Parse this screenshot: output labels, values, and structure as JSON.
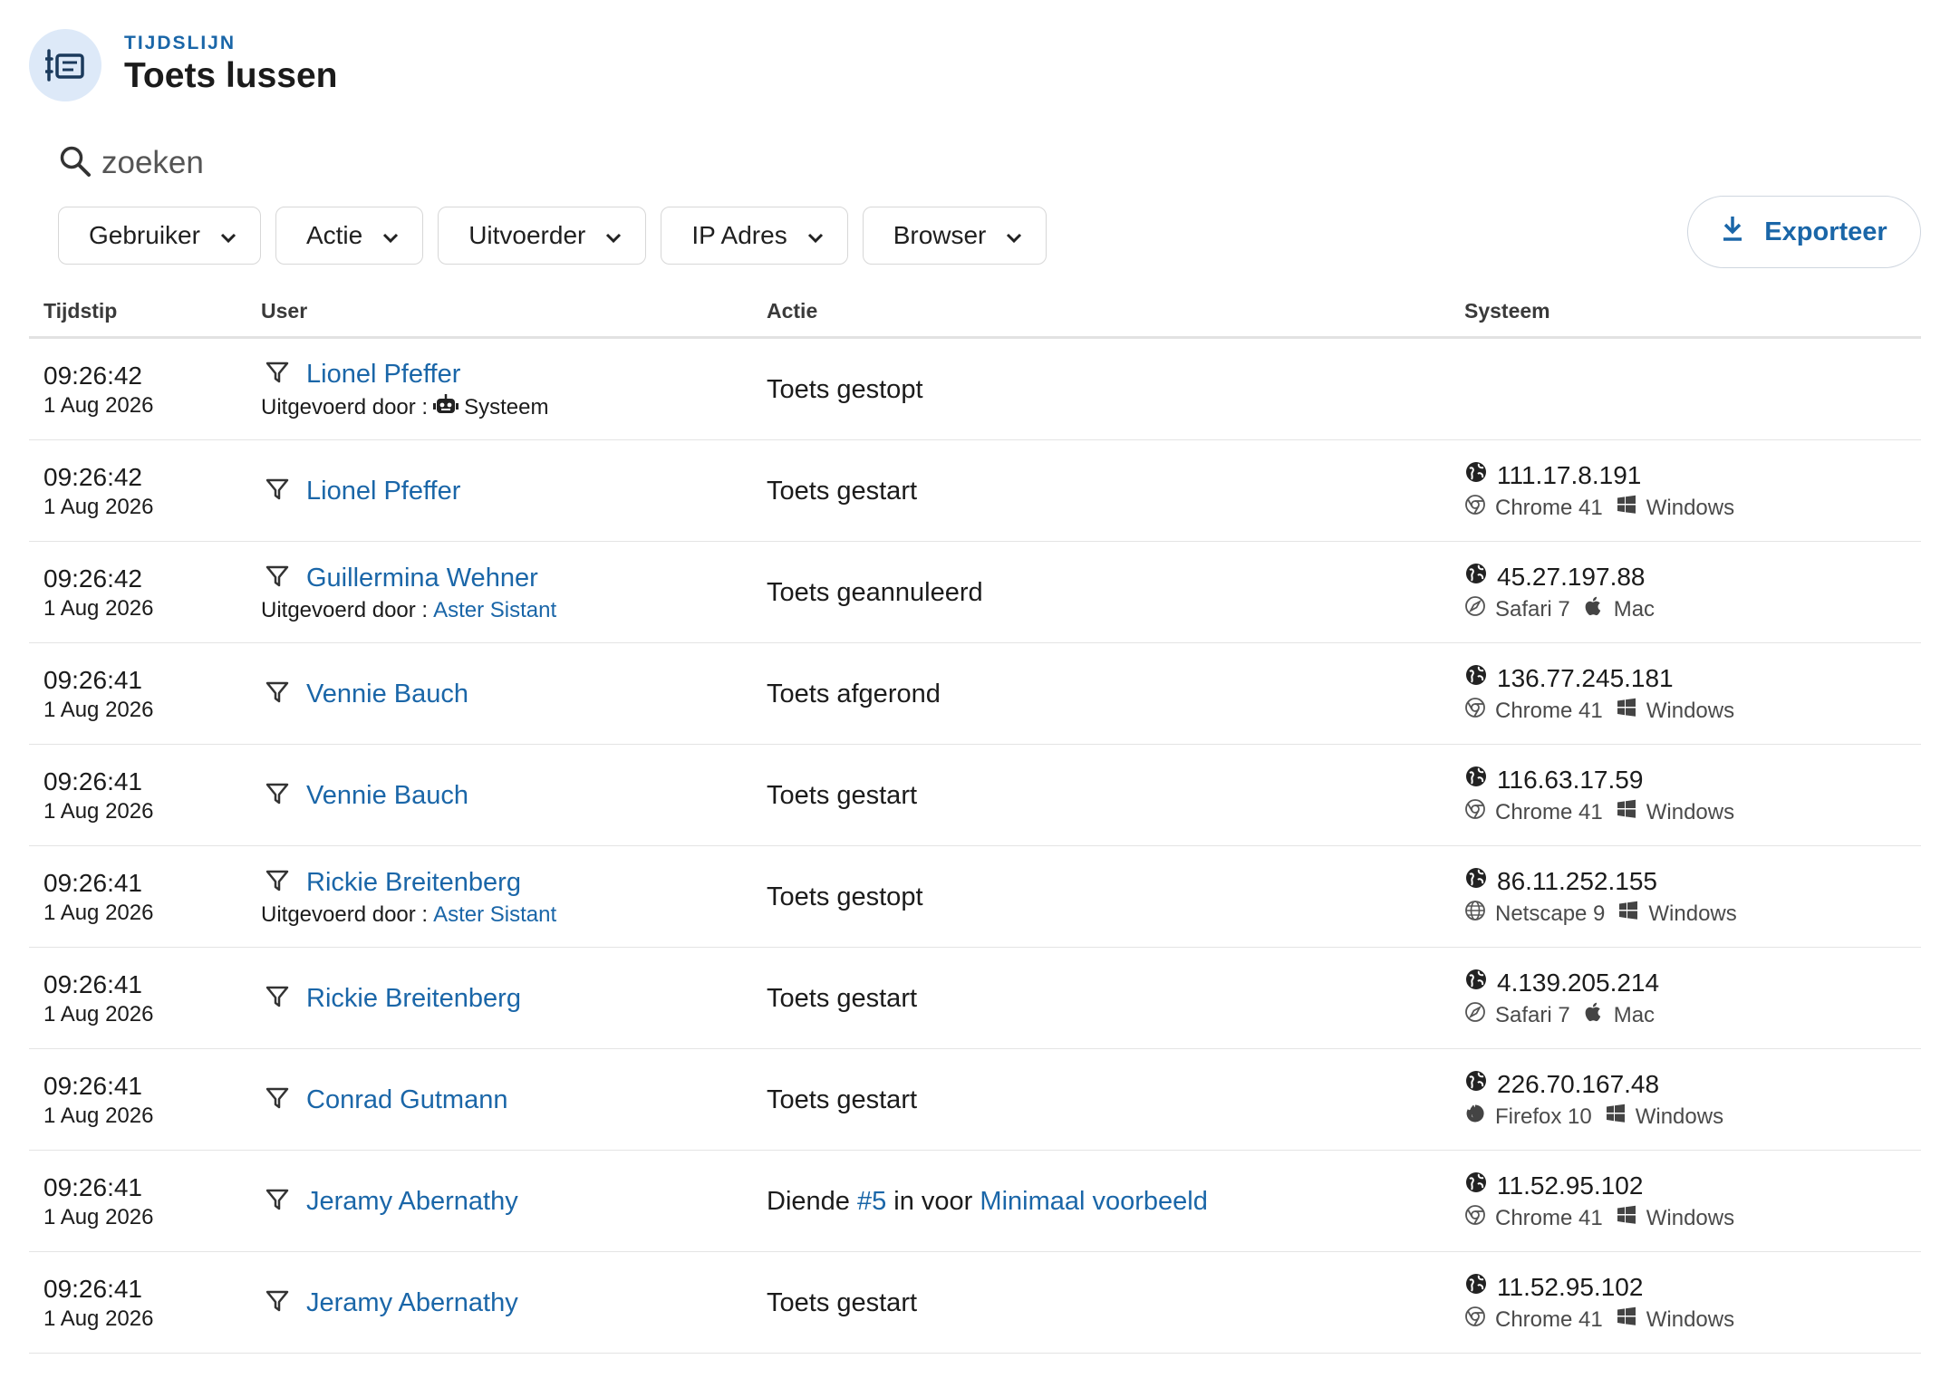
{
  "header": {
    "kicker": "TIJDSLIJN",
    "title": "Toets lussen"
  },
  "search": {
    "placeholder": "zoeken"
  },
  "filters": [
    {
      "label": "Gebruiker"
    },
    {
      "label": "Actie"
    },
    {
      "label": "Uitvoerder"
    },
    {
      "label": "IP Adres"
    },
    {
      "label": "Browser"
    }
  ],
  "export_label": "Exporteer",
  "table": {
    "headers": {
      "time": "Tijdstip",
      "user": "User",
      "action": "Actie",
      "system": "Systeem"
    },
    "by_prefix": "Uitgevoerd door :",
    "rows": [
      {
        "time": "09:26:42",
        "date": "1 Aug 2026",
        "user": "Lionel Pfeffer",
        "by": "Systeem",
        "by_type": "system",
        "action": {
          "type": "text",
          "text": "Toets gestopt"
        },
        "ip": "",
        "browser": "",
        "browser_icon": "",
        "os": "",
        "os_icon": ""
      },
      {
        "time": "09:26:42",
        "date": "1 Aug 2026",
        "user": "Lionel Pfeffer",
        "by": "",
        "by_type": "",
        "action": {
          "type": "text",
          "text": "Toets gestart"
        },
        "ip": "111.17.8.191",
        "browser": "Chrome 41",
        "browser_icon": "chrome-icon",
        "os": "Windows",
        "os_icon": "windows-icon"
      },
      {
        "time": "09:26:42",
        "date": "1 Aug 2026",
        "user": "Guillermina Wehner",
        "by": "Aster Sistant",
        "by_type": "user",
        "action": {
          "type": "text",
          "text": "Toets geannuleerd"
        },
        "ip": "45.27.197.88",
        "browser": "Safari 7",
        "browser_icon": "safari-icon",
        "os": "Mac",
        "os_icon": "apple-icon"
      },
      {
        "time": "09:26:41",
        "date": "1 Aug 2026",
        "user": "Vennie Bauch",
        "by": "",
        "by_type": "",
        "action": {
          "type": "text",
          "text": "Toets afgerond"
        },
        "ip": "136.77.245.181",
        "browser": "Chrome 41",
        "browser_icon": "chrome-icon",
        "os": "Windows",
        "os_icon": "windows-icon"
      },
      {
        "time": "09:26:41",
        "date": "1 Aug 2026",
        "user": "Vennie Bauch",
        "by": "",
        "by_type": "",
        "action": {
          "type": "text",
          "text": "Toets gestart"
        },
        "ip": "116.63.17.59",
        "browser": "Chrome 41",
        "browser_icon": "chrome-icon",
        "os": "Windows",
        "os_icon": "windows-icon"
      },
      {
        "time": "09:26:41",
        "date": "1 Aug 2026",
        "user": "Rickie Breitenberg",
        "by": "Aster Sistant",
        "by_type": "user",
        "action": {
          "type": "text",
          "text": "Toets gestopt"
        },
        "ip": "86.11.252.155",
        "browser": "Netscape 9",
        "browser_icon": "globe-outline-icon",
        "os": "Windows",
        "os_icon": "windows-icon"
      },
      {
        "time": "09:26:41",
        "date": "1 Aug 2026",
        "user": "Rickie Breitenberg",
        "by": "",
        "by_type": "",
        "action": {
          "type": "text",
          "text": "Toets gestart"
        },
        "ip": "4.139.205.214",
        "browser": "Safari 7",
        "browser_icon": "safari-icon",
        "os": "Mac",
        "os_icon": "apple-icon"
      },
      {
        "time": "09:26:41",
        "date": "1 Aug 2026",
        "user": "Conrad Gutmann",
        "by": "",
        "by_type": "",
        "action": {
          "type": "text",
          "text": "Toets gestart"
        },
        "ip": "226.70.167.48",
        "browser": "Firefox 10",
        "browser_icon": "firefox-icon",
        "os": "Windows",
        "os_icon": "windows-icon"
      },
      {
        "time": "09:26:41",
        "date": "1 Aug 2026",
        "user": "Jeramy Abernathy",
        "by": "",
        "by_type": "",
        "action": {
          "type": "submit",
          "pre": "Diende",
          "link1": "#5",
          "mid": "in voor",
          "link2": "Minimaal voorbeeld"
        },
        "ip": "11.52.95.102",
        "browser": "Chrome 41",
        "browser_icon": "chrome-icon",
        "os": "Windows",
        "os_icon": "windows-icon"
      },
      {
        "time": "09:26:41",
        "date": "1 Aug 2026",
        "user": "Jeramy Abernathy",
        "by": "",
        "by_type": "",
        "action": {
          "type": "text",
          "text": "Toets gestart"
        },
        "ip": "11.52.95.102",
        "browser": "Chrome 41",
        "browser_icon": "chrome-icon",
        "os": "Windows",
        "os_icon": "windows-icon"
      }
    ]
  },
  "colors": {
    "accent": "#1a66a8",
    "header_icon_bg": "#dde9f8",
    "border": "#e4e4e4"
  }
}
